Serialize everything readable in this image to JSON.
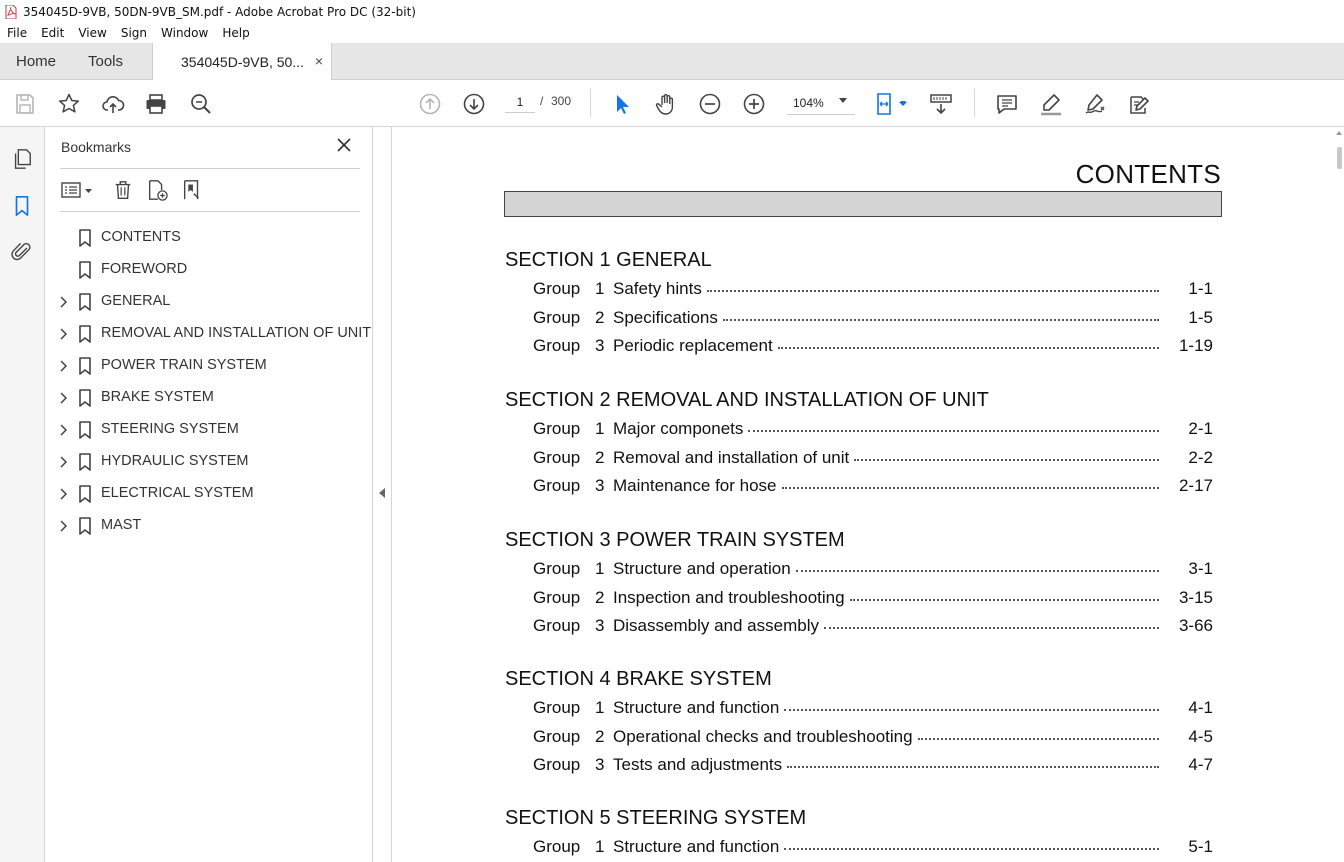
{
  "window": {
    "title": "354045D-9VB, 50DN-9VB_SM.pdf - Adobe Acrobat Pro DC (32-bit)"
  },
  "menu": [
    "File",
    "Edit",
    "View",
    "Sign",
    "Window",
    "Help"
  ],
  "tabs": {
    "home": "Home",
    "tools": "Tools",
    "document": "354045D-9VB, 50...",
    "close_glyph": "×"
  },
  "toolbar": {
    "page_current": "1",
    "page_separator": "/",
    "page_total": "300",
    "zoom": "104%",
    "icons_left": [
      "save-icon",
      "star-icon",
      "upload-icon",
      "print-icon",
      "zoom-search-icon"
    ],
    "icons_nav": [
      "page-up-icon",
      "page-down-icon"
    ],
    "icons_center": [
      "select-arrow-icon",
      "hand-icon",
      "zoom-out-icon",
      "zoom-in-icon"
    ],
    "icons_right": [
      "fit-page-icon",
      "scroll-mode-icon",
      "comment-icon",
      "highlight-icon",
      "sign-icon",
      "edit-icon"
    ]
  },
  "rail": [
    "pages-icon",
    "bookmarks-icon",
    "attachments-icon"
  ],
  "bookmarks": {
    "title": "Bookmarks",
    "items": [
      {
        "label": "CONTENTS",
        "expandable": false
      },
      {
        "label": "FOREWORD",
        "expandable": false
      },
      {
        "label": "GENERAL",
        "expandable": true
      },
      {
        "label": "REMOVAL AND INSTALLATION OF UNIT",
        "expandable": true
      },
      {
        "label": "POWER TRAIN SYSTEM",
        "expandable": true
      },
      {
        "label": "BRAKE SYSTEM",
        "expandable": true
      },
      {
        "label": "STEERING SYSTEM",
        "expandable": true
      },
      {
        "label": "HYDRAULIC SYSTEM",
        "expandable": true
      },
      {
        "label": "ELECTRICAL SYSTEM",
        "expandable": true
      },
      {
        "label": "MAST",
        "expandable": true
      }
    ]
  },
  "document": {
    "heading": "CONTENTS",
    "group_word": "Group",
    "sections": [
      {
        "title": "SECTION 1  GENERAL",
        "groups": [
          {
            "num": "1",
            "title": "Safety hints",
            "page": "1-1"
          },
          {
            "num": "2",
            "title": "Specifications",
            "page": "1-5"
          },
          {
            "num": "3",
            "title": "Periodic replacement",
            "page": "1-19"
          }
        ]
      },
      {
        "title": "SECTION 2  REMOVAL AND INSTALLATION OF UNIT",
        "groups": [
          {
            "num": "1",
            "title": "Major componets",
            "page": "2-1"
          },
          {
            "num": "2",
            "title": "Removal and installation of unit",
            "page": "2-2"
          },
          {
            "num": "3",
            "title": "Maintenance for hose",
            "page": "2-17"
          }
        ]
      },
      {
        "title": "SECTION 3  POWER TRAIN SYSTEM",
        "groups": [
          {
            "num": "1",
            "title": "Structure and operation",
            "page": "3-1"
          },
          {
            "num": "2",
            "title": "Inspection and troubleshooting",
            "page": "3-15"
          },
          {
            "num": "3",
            "title": "Disassembly and assembly",
            "page": "3-66"
          }
        ]
      },
      {
        "title": "SECTION 4  BRAKE SYSTEM",
        "groups": [
          {
            "num": "1",
            "title": "Structure and function",
            "page": "4-1"
          },
          {
            "num": "2",
            "title": "Operational checks and troubleshooting",
            "page": "4-5"
          },
          {
            "num": "3",
            "title": "Tests and adjustments",
            "page": "4-7"
          }
        ]
      },
      {
        "title": "SECTION 5  STEERING SYSTEM",
        "groups": [
          {
            "num": "1",
            "title": "Structure and function",
            "page": "5-1"
          }
        ]
      }
    ]
  },
  "colors": {
    "accent": "#1473e6",
    "pdf_red": "#d7373f",
    "tabbar": "#e6e6e6"
  }
}
